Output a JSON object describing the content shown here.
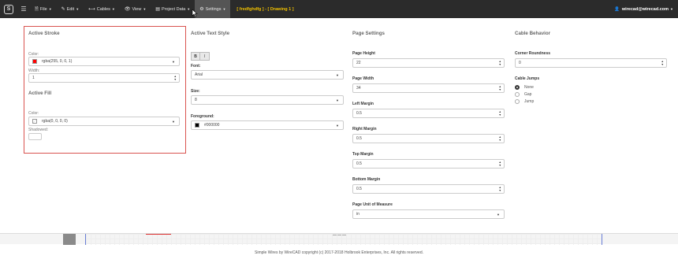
{
  "navbar": {
    "menus": [
      {
        "icon": "☰",
        "label": ""
      },
      {
        "icon": "🗎",
        "label": "File"
      },
      {
        "icon": "✎",
        "label": "Edit"
      },
      {
        "icon": "⟷",
        "label": "Cables"
      },
      {
        "icon": "👁",
        "label": "View"
      },
      {
        "icon": "▤",
        "label": "Project Data"
      },
      {
        "icon": "⚙",
        "label": "Settings"
      }
    ],
    "title": "[ fredfghdfg ] - [ Drawing 1 ]",
    "user": "wirecad@wirecad.com",
    "user_icon": "👤"
  },
  "stroke": {
    "heading": "Active Stroke",
    "color_label": "Color:",
    "color_value": "rgba(255, 0, 0, 1)",
    "swatch": "#ff0000",
    "width_label": "Width:",
    "width_value": "1"
  },
  "fill": {
    "heading": "Active Fill",
    "color_label": "Color:",
    "color_value": "rgba(0, 0, 0, 0)",
    "shadowed_label": "Shadowed:"
  },
  "text_style": {
    "heading": "Active Text Style",
    "bold": "B",
    "italic": "I",
    "font_label": "Font:",
    "font_value": "Arial",
    "size_label": "Size:",
    "size_value": "8",
    "fg_label": "Foreground:",
    "fg_value": "#000000",
    "fg_swatch": "#000000"
  },
  "page_settings": {
    "heading": "Page Settings",
    "fields": [
      {
        "label": "Page Height",
        "value": "22"
      },
      {
        "label": "Page Width",
        "value": "34"
      },
      {
        "label": "Left Margin",
        "value": "0.5"
      },
      {
        "label": "Right Margin",
        "value": "0.5"
      },
      {
        "label": "Top Margin",
        "value": "0.5"
      },
      {
        "label": "Bottom Margin",
        "value": "0.5"
      }
    ],
    "unit_label": "Page Unit of Measure",
    "unit_value": "in"
  },
  "cable_behavior": {
    "heading": "Cable Behavior",
    "roundness_label": "Corner Roundness",
    "roundness_value": "0",
    "jumps_label": "Cable Jumps",
    "options": [
      "None",
      "Gap",
      "Jump"
    ],
    "selected": "None"
  },
  "footer": "Simple Wires by WireCAD copyright (c) 2017-2018 Holbrook Enterprises, Inc. All rights reserved."
}
